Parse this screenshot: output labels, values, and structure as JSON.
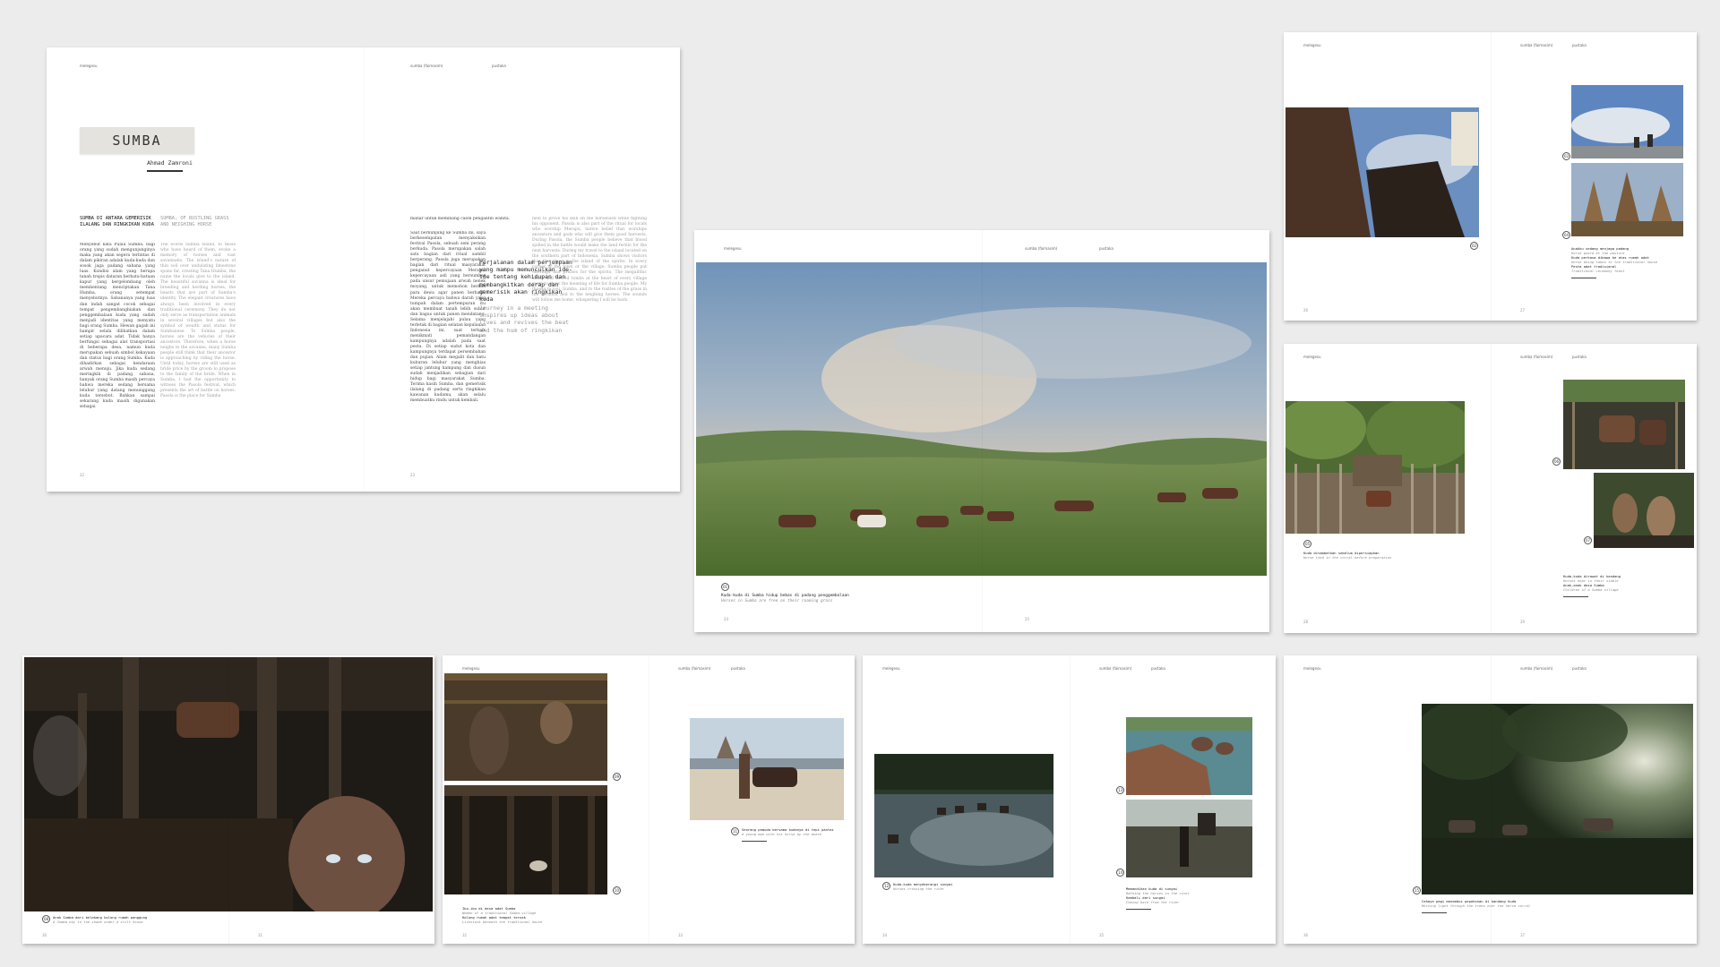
{
  "cover": {
    "title": "SUMBA",
    "author": "Ahmad Zamroni",
    "header_left": "melegesu",
    "header_mid": "sumba (faimasim)",
    "header_right": "pustaka",
    "heading_id": "SUMBA DI ANTARA GEMERISIK ILALANG DAN RINGKIKAN KUDA",
    "heading_en": "SUMBA, OF RUSTLING GRASS AND NEIGHING HORSE",
    "col1": "Menyebut kata Pulau Sumba, bagi orang yang sudah mengunjunginya maka yang akan segera terlintas di dalam pikiran adalah kuda-kuda dan sosok jaga padang sabana yang luas. Kondisi alam yang berupa tanah tropis dataran berbatu-batuan kapur yang bergelombang oleh membentang menciptakan Tana Humba, orang setempat menyebutnya. Sabananya yang luas dan indah sangat cocok sebagai tempat pengembangbiakan dan penggembalaan kuda yang sudah menjadi identitas yang menyatu bagi orang Sumba. Hewan gagah ini hampir selalu dilibatkan dalam setiap upacara adat. Tidak hanya berfungsi sebagai alat transportasi di beberapa desa, namun kuda merupakan sebuah simbol kekayaan dan status bagi orang Sumba. Kuda dihadirkan sebagai kendaraan arwah menuju. Jika kuda sedang meringkik di padang sabana, banyak orang Sumba masih percaya bahwa mereka sedang bersama leluhur yang datang menunggang kuda tersebut. Bahkan sampai sekarang kuda masih digunakan sebagai",
    "col2": "The words Sumba Island, to those who have heard of them, evoke a memory of horses and vast savannahs. The island's nature of thin soil over undulating limestone spans far, creating Tana Humba, the name the locals give to the island. The beautiful savanna is ideal for breeding and herding horses, the beasts that are part of Sumba's identity. The elegant creatures have always been involved in every traditional ceremony. They do not only serve as transportation animals in several villages but also the symbol of wealth and status for Sumbanese. To Sumba people, horses are the vehicles of their ancestors. Therefore, when a horse neighs in the savanna, many Sumba people still think that their ancestor is approaching by riding the horse. Until today, horses are still used as bride price by the groom to propose to the family of the bride. When in Sumba, I had the opportunity to witness the Pasola festival, which presents the art of battle on horses. Pasola is the place for Sumba",
    "col3_top": "mahar untuk meminang calon pengantin wanita.",
    "col3": "Saat berkunjung ke Sumba ini, saya berkesempatan menyaksikan festival Pasola, sebuah seni perang berkuda. Pasola merupakan salah satu bagian dari ritual sambil berperang. Pasola juga merupakan bagian dari ritual masyarakat penganut kepercayaan Merapu, kepercayaan asli yang bersumber pada unsur pemujaan arwah nenek moyang, untuk memohon berkah para dewa agar panen berhasil. Mereka percaya bahwa darah yang tumpah dalam pertempuran itu akan membuat tanah lebih subur dan bagus untuk panen mendatang. Selama menjelajahi pulau yang terletak di bagian selatan kepulauan Indonesia ini, saat terbaik menikmati pemandangan kampungnya adalah pada saat pesta. Di setiap sudut kota dan kampungnya terdapat persembahan dan pujian. Alam megalit dan batu kuburan leluhur yang menghias setiap jantung kampung dan dusun sudah menjadikan sebagian dari hidup bagi masyarakat Sumba. Terima kasih Sumba, dan gemerisik ilalang di padang serta ringkikan kawanan kudamu, akan selalu membuatku rindu untuk kembali.",
    "col4": "men to prove his skill on the horseback while fighting his opponent. Pasola is also part of the ritual for locals who worship Merapu, native belief that worships ancestors and gods who will give them good harvests. During Pasola, the Sumba people believe that blood spilled in the battle would make the land fertile for the next harvests. During my travel to the island located on the southern part of Indonesia, Sumba shows visitors that the place is the island of the spirits. In every corner of the town or the village, Sumba people put offerings and praises for the spirits. The megalithic altars and sacred tombs at the heart of every village seem to show the meaning of life for Sumba people. My thanks to you, Sumba, and to the rustles of the grass in the savanna and to the neighing horses. The sounds will follow me home, whispering I will be back.",
    "pull_id": "Perjalanan dalam perjumpaan yang mampu memunculkan ide-ide tentang kehidupan dan membangkitkan derap dan gemerisik akan ringkikan kuda",
    "pull_en": "Journey in a meeting inspires up ideas about lives and revives the beat and the hum of ringkikan",
    "folio_l": "22",
    "folio_r": "23"
  },
  "landscape": {
    "header_left": "melegesu",
    "header_mid": "sumba (faimasim)",
    "header_right": "pustaka",
    "num": "01",
    "caption_id": "Kuda-kuda di Sumba hidup bebas di padang penggembalaan",
    "caption_en": "Horses in Sumba are free on their roaming grass",
    "folio_l": "24",
    "folio_r": "25"
  },
  "riders": {
    "header_left": "melegesu",
    "header_mid": "sumba (faimasim)",
    "header_right": "pustaka",
    "nums": [
      "02",
      "03",
      "04"
    ],
    "caption1_id": "Anakku sedang menjaga padang",
    "caption1_en": "Horse guard at the pasture",
    "caption2_id": "Kuda perkasa dibawa ke atas rumah adat",
    "caption2_en": "Horse being taken to the traditional house",
    "caption3_id": "Pesta adat tradisional",
    "caption3_en": "Traditional ceremony feast",
    "folio_l": "26",
    "folio_r": "27"
  },
  "corral": {
    "header_left": "melegesu",
    "header_mid": "sumba (faimasim)",
    "header_right": "pustaka",
    "nums": [
      "05",
      "06",
      "07"
    ],
    "caption1_id": "Kuda ditambatkan sebelum dipersiapkan",
    "caption1_en": "Horse tied in the corral before preparation",
    "caption2_id": "Kuda-kuda dirawat di kandang",
    "caption2_en": "Horses kept in their stable",
    "caption3_id": "Anak-anak desa Sumba",
    "caption3_en": "Children of a Sumba village",
    "folio_l": "28",
    "folio_r": "29"
  },
  "stable": {
    "caption_id": "Anak Sumba dari belakang kolong rumah panggung",
    "caption_en": "A Sumba boy in the shade under a stilt house",
    "num": "08",
    "folio_l": "30",
    "folio_r": "31"
  },
  "villagers": {
    "header_left": "melegesu",
    "header_mid": "sumba (faimasim)",
    "header_right": "pustaka",
    "nums": [
      "09",
      "10",
      "11"
    ],
    "caption1_id": "Ibu-ibu di desa adat Sumba",
    "caption1_en": "Women of a traditional Sumba village",
    "caption2_id": "Kolong rumah adat tempat ternak",
    "caption2_en": "Livestock beneath the traditional house",
    "caption3_id": "Seorang pemuda bersama kudanya di tepi pantai",
    "caption3_en": "A young man with his horse by the beach",
    "folio_l": "32",
    "folio_r": "33"
  },
  "river": {
    "header_left": "melegesu",
    "header_mid": "sumba (faimasim)",
    "header_right": "pustaka",
    "nums": [
      "12",
      "13",
      "14"
    ],
    "caption1_id": "Kuda-kuda menyeberangi sungai",
    "caption1_en": "Horses crossing the river",
    "caption2_id": "Memandikan kuda di sungai",
    "caption2_en": "Bathing the horses in the river",
    "caption3_id": "Kembali dari sungai",
    "caption3_en": "Coming back from the river",
    "folio_l": "34",
    "folio_r": "35"
  },
  "forest": {
    "header_left": "melegesu",
    "header_mid": "sumba (faimasim)",
    "header_right": "pustaka",
    "num": "15",
    "caption_id": "Cahaya pagi menembus pepohonan di kandang kuda",
    "caption_en": "Morning light through the trees over the horse corral",
    "folio_l": "36",
    "folio_r": "37"
  }
}
